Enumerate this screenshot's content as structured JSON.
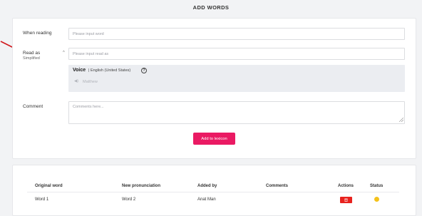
{
  "page": {
    "title": "ADD WORDS"
  },
  "form": {
    "when_reading_label": "When reading",
    "when_reading_placeholder": "Please input word",
    "read_as_label": "Read as",
    "read_as_sublabel": "Simplified",
    "read_as_placeholder": "Please input read as",
    "voice": {
      "title": "Voice",
      "language": "| English (United States)",
      "help_glyph": "?",
      "voice_name": "Matthew"
    },
    "comment_label": "Comment",
    "comment_placeholder": "Comments here...",
    "submit_label": "Add to lexicon"
  },
  "table": {
    "headers": [
      "Original word",
      "New pronunciation",
      "Added by",
      "Comments",
      "Actions",
      "Status"
    ],
    "rows": [
      {
        "original": "Word 1",
        "pronunciation": "Word 2",
        "added_by": "Anat Man",
        "comments": ""
      }
    ]
  },
  "colors": {
    "accent": "#ea1a63",
    "delete": "#e8221e",
    "status_pending": "#f4c21b",
    "annotation_arrow": "#d0161b"
  },
  "icons": [
    "chevron-up-icon",
    "help-icon",
    "speaker-icon",
    "resize-grip-icon",
    "trash-icon",
    "status-dot-icon",
    "annotation-arrow-icon"
  ]
}
